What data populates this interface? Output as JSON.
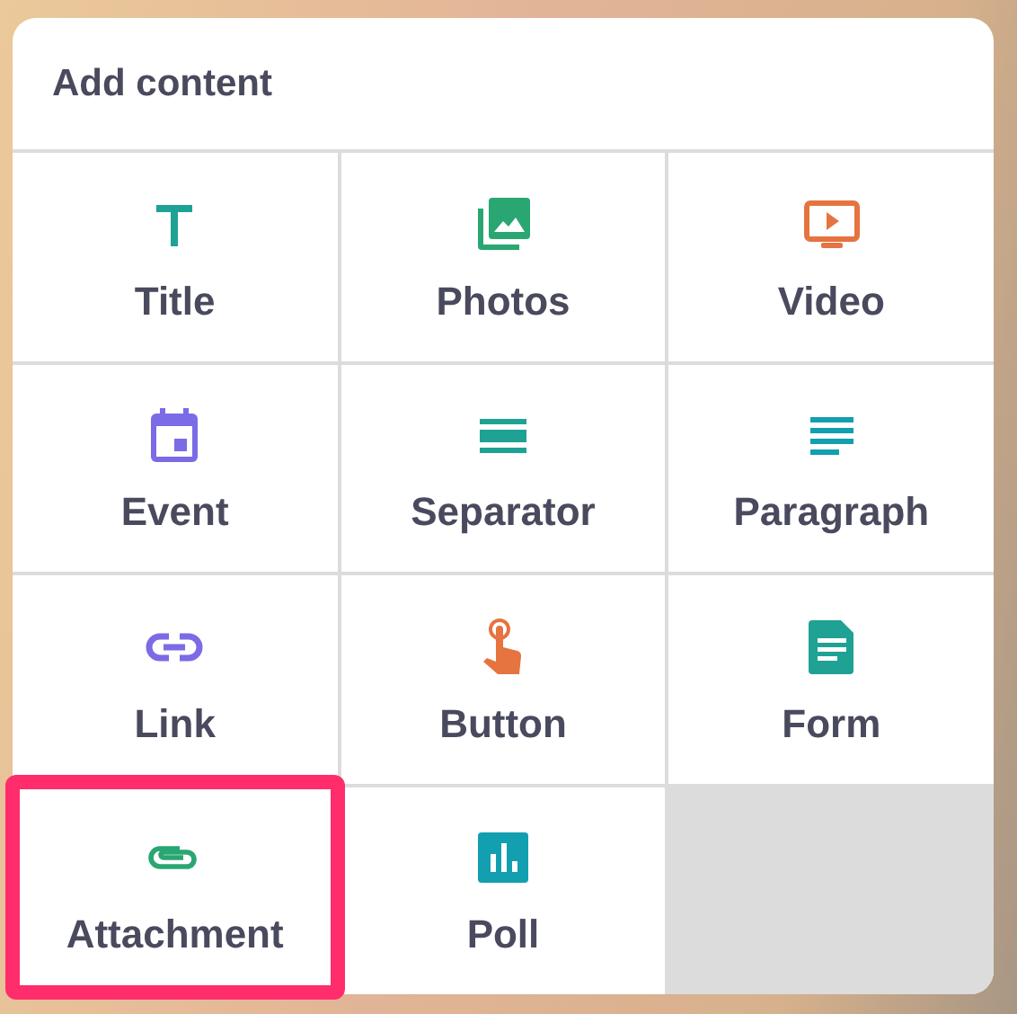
{
  "panel": {
    "title": "Add content"
  },
  "items": [
    {
      "label": "Title",
      "kind": "title",
      "color": "#1fa293",
      "highlighted": false
    },
    {
      "label": "Photos",
      "kind": "photos",
      "color": "#2aa672",
      "highlighted": false
    },
    {
      "label": "Video",
      "kind": "video",
      "color": "#e57440",
      "highlighted": false
    },
    {
      "label": "Event",
      "kind": "event",
      "color": "#7b6be6",
      "highlighted": false
    },
    {
      "label": "Separator",
      "kind": "separator",
      "color": "#1fa293",
      "highlighted": false
    },
    {
      "label": "Paragraph",
      "kind": "paragraph",
      "color": "#129fb0",
      "highlighted": false
    },
    {
      "label": "Link",
      "kind": "link",
      "color": "#7b6be6",
      "highlighted": false
    },
    {
      "label": "Button",
      "kind": "button",
      "color": "#e57440",
      "highlighted": false
    },
    {
      "label": "Form",
      "kind": "form",
      "color": "#1fa293",
      "highlighted": false
    },
    {
      "label": "Attachment",
      "kind": "attachment",
      "color": "#2aa672",
      "highlighted": true
    },
    {
      "label": "Poll",
      "kind": "poll",
      "color": "#129fb0",
      "highlighted": false
    }
  ]
}
